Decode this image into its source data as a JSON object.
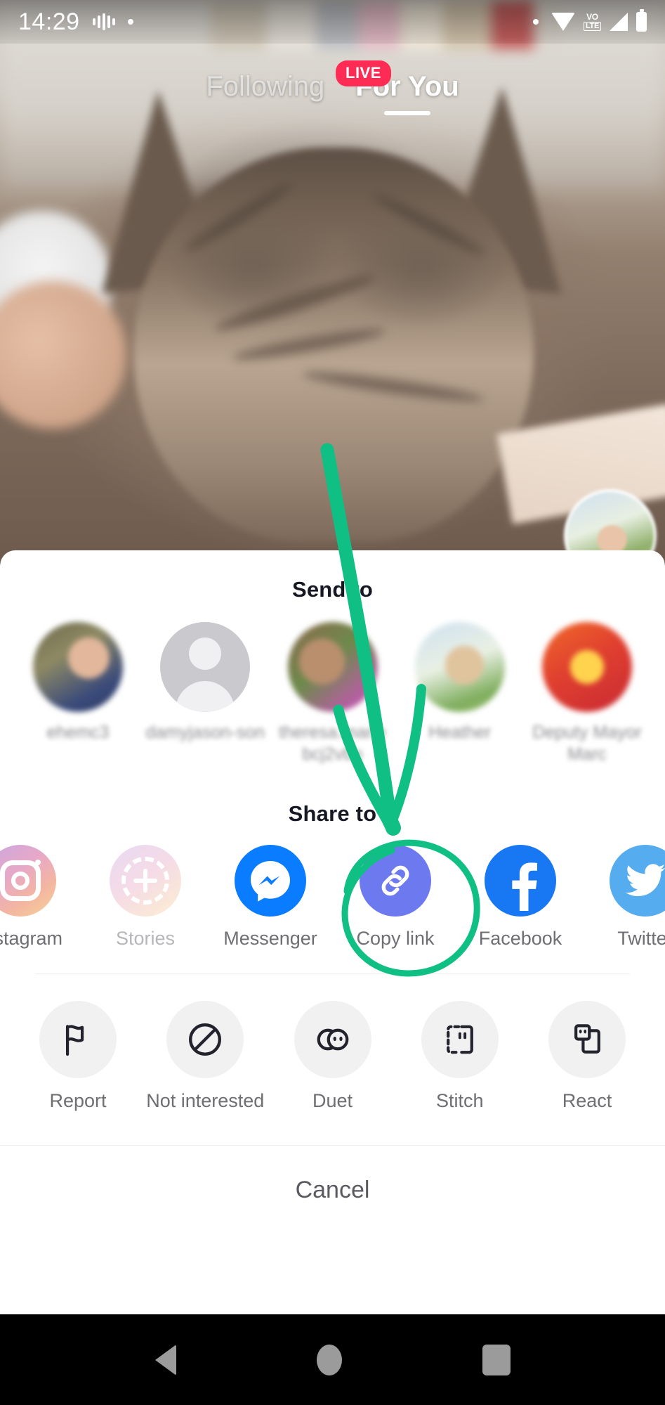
{
  "status_bar": {
    "time": "14:29",
    "icons": [
      "assistant-dots-icon",
      "dot-icon",
      "wifi-icon",
      "volte-icon",
      "signal-icon",
      "battery-icon"
    ],
    "volte_top": "VO",
    "volte_bottom": "LTE"
  },
  "feed_tabs": {
    "following": "Following",
    "live_badge": "LIVE",
    "for_you": "For You",
    "active": "For You"
  },
  "share_sheet": {
    "send_to_title": "Send to",
    "share_to_title": "Share to",
    "cancel_label": "Cancel",
    "contacts": [
      {
        "name": "ehemc3",
        "avatar": "photo-avatar"
      },
      {
        "name": "damyjason-son",
        "avatar": "default-person-avatar"
      },
      {
        "name": "theresa.marie bcj2vbn",
        "avatar": "photo-avatar"
      },
      {
        "name": "Heather",
        "avatar": "photo-avatar"
      },
      {
        "name": "Deputy Mayor Marc",
        "avatar": "photo-avatar"
      }
    ],
    "share_apps": [
      {
        "label": "Instagram",
        "icon": "instagram-icon",
        "color": "#e7a8c8",
        "dimmed": false
      },
      {
        "label": "Stories",
        "icon": "stories-icon",
        "color": "#e7aac8",
        "dimmed": true
      },
      {
        "label": "Messenger",
        "icon": "messenger-icon",
        "color": "#0a7cff",
        "dimmed": false
      },
      {
        "label": "Copy link",
        "icon": "copy-link-icon",
        "color": "#6c79ef",
        "dimmed": false,
        "highlighted": true
      },
      {
        "label": "Facebook",
        "icon": "facebook-icon",
        "color": "#1877f2",
        "dimmed": false
      },
      {
        "label": "Twitter",
        "icon": "twitter-icon",
        "color": "#55acee",
        "dimmed": false
      }
    ],
    "actions": [
      {
        "label": "Report",
        "icon": "flag-icon"
      },
      {
        "label": "Not\ninterested",
        "icon": "block-icon"
      },
      {
        "label": "Duet",
        "icon": "duet-icon"
      },
      {
        "label": "Stitch",
        "icon": "stitch-icon"
      },
      {
        "label": "React",
        "icon": "react-icon"
      }
    ]
  },
  "annotation": {
    "color": "#0fbf84",
    "arrow_target": "Copy link",
    "circle_target": "copy-link-icon"
  },
  "nav_bar": {
    "back": "back-icon",
    "home": "home-icon",
    "recents": "recents-icon"
  }
}
